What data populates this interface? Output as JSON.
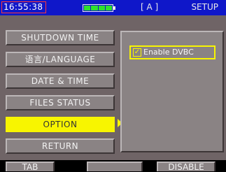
{
  "status_bar": {
    "clock": "16:55:38",
    "mode": "[ A ]",
    "title": "SETUP",
    "battery_level": 1.0,
    "battery_icon": "battery-full-icon"
  },
  "menu": {
    "items": [
      {
        "label": "SHUTDOWN TIME"
      },
      {
        "label": "语言/LANGUAGE"
      },
      {
        "label": "DATE & TIME"
      },
      {
        "label": "FILES STATUS"
      },
      {
        "label": "OPTION"
      },
      {
        "label": "RETURN"
      }
    ],
    "selected": "OPTION"
  },
  "panel": {
    "option_label": "Enable DVBC",
    "option_checked": true
  },
  "softkeys": [
    {
      "label": "TAB"
    },
    {
      "label": ""
    },
    {
      "label": "DISABLE"
    }
  ],
  "colors": {
    "status_bar_bg": "#0f17c9",
    "body_bg": "#6f6466",
    "highlight": "#f8f500",
    "button_bg": "#8a8384"
  }
}
